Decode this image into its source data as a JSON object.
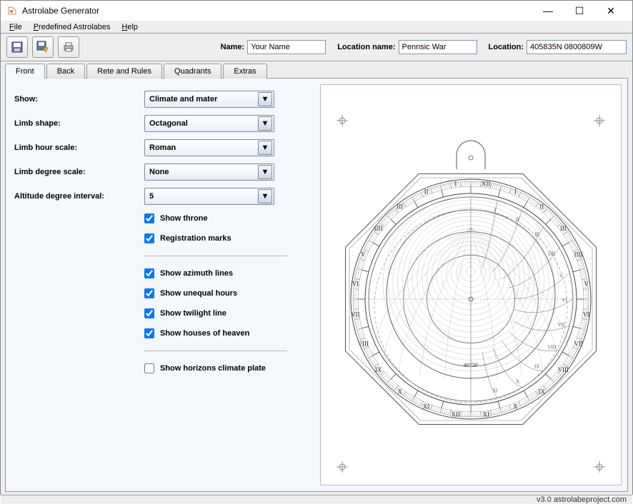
{
  "window": {
    "title": "Astrolabe Generator"
  },
  "menu": {
    "file": "File",
    "predefined": "Predefined Astrolabes",
    "help": "Help"
  },
  "form": {
    "name_label": "Name:",
    "name_value": "Your Name",
    "locname_label": "Location name:",
    "locname_value": "Pennsic War",
    "loc_label": "Location:",
    "loc_value": "405835N 0800809W"
  },
  "tabs": [
    "Front",
    "Back",
    "Rete and Rules",
    "Quadrants",
    "Extras"
  ],
  "fields": {
    "show_label": "Show:",
    "show_value": "Climate and mater",
    "limb_shape_label": "Limb shape:",
    "limb_shape_value": "Octagonal",
    "limb_hour_label": "Limb hour scale:",
    "limb_hour_value": "Roman",
    "limb_degree_label": "Limb degree scale:",
    "limb_degree_value": "None",
    "alt_interval_label": "Altitude degree interval:",
    "alt_interval_value": "5"
  },
  "checks": {
    "throne": "Show throne",
    "regmarks": "Registration marks",
    "azimuth": "Show azimuth lines",
    "unequal": "Show unequal hours",
    "twilight": "Show twilight line",
    "houses": "Show houses of heaven",
    "horizons": "Show horizons climate plate"
  },
  "preview": {
    "lat_label": "40°58'"
  },
  "status": "v3.0 astrolabeproject.com"
}
